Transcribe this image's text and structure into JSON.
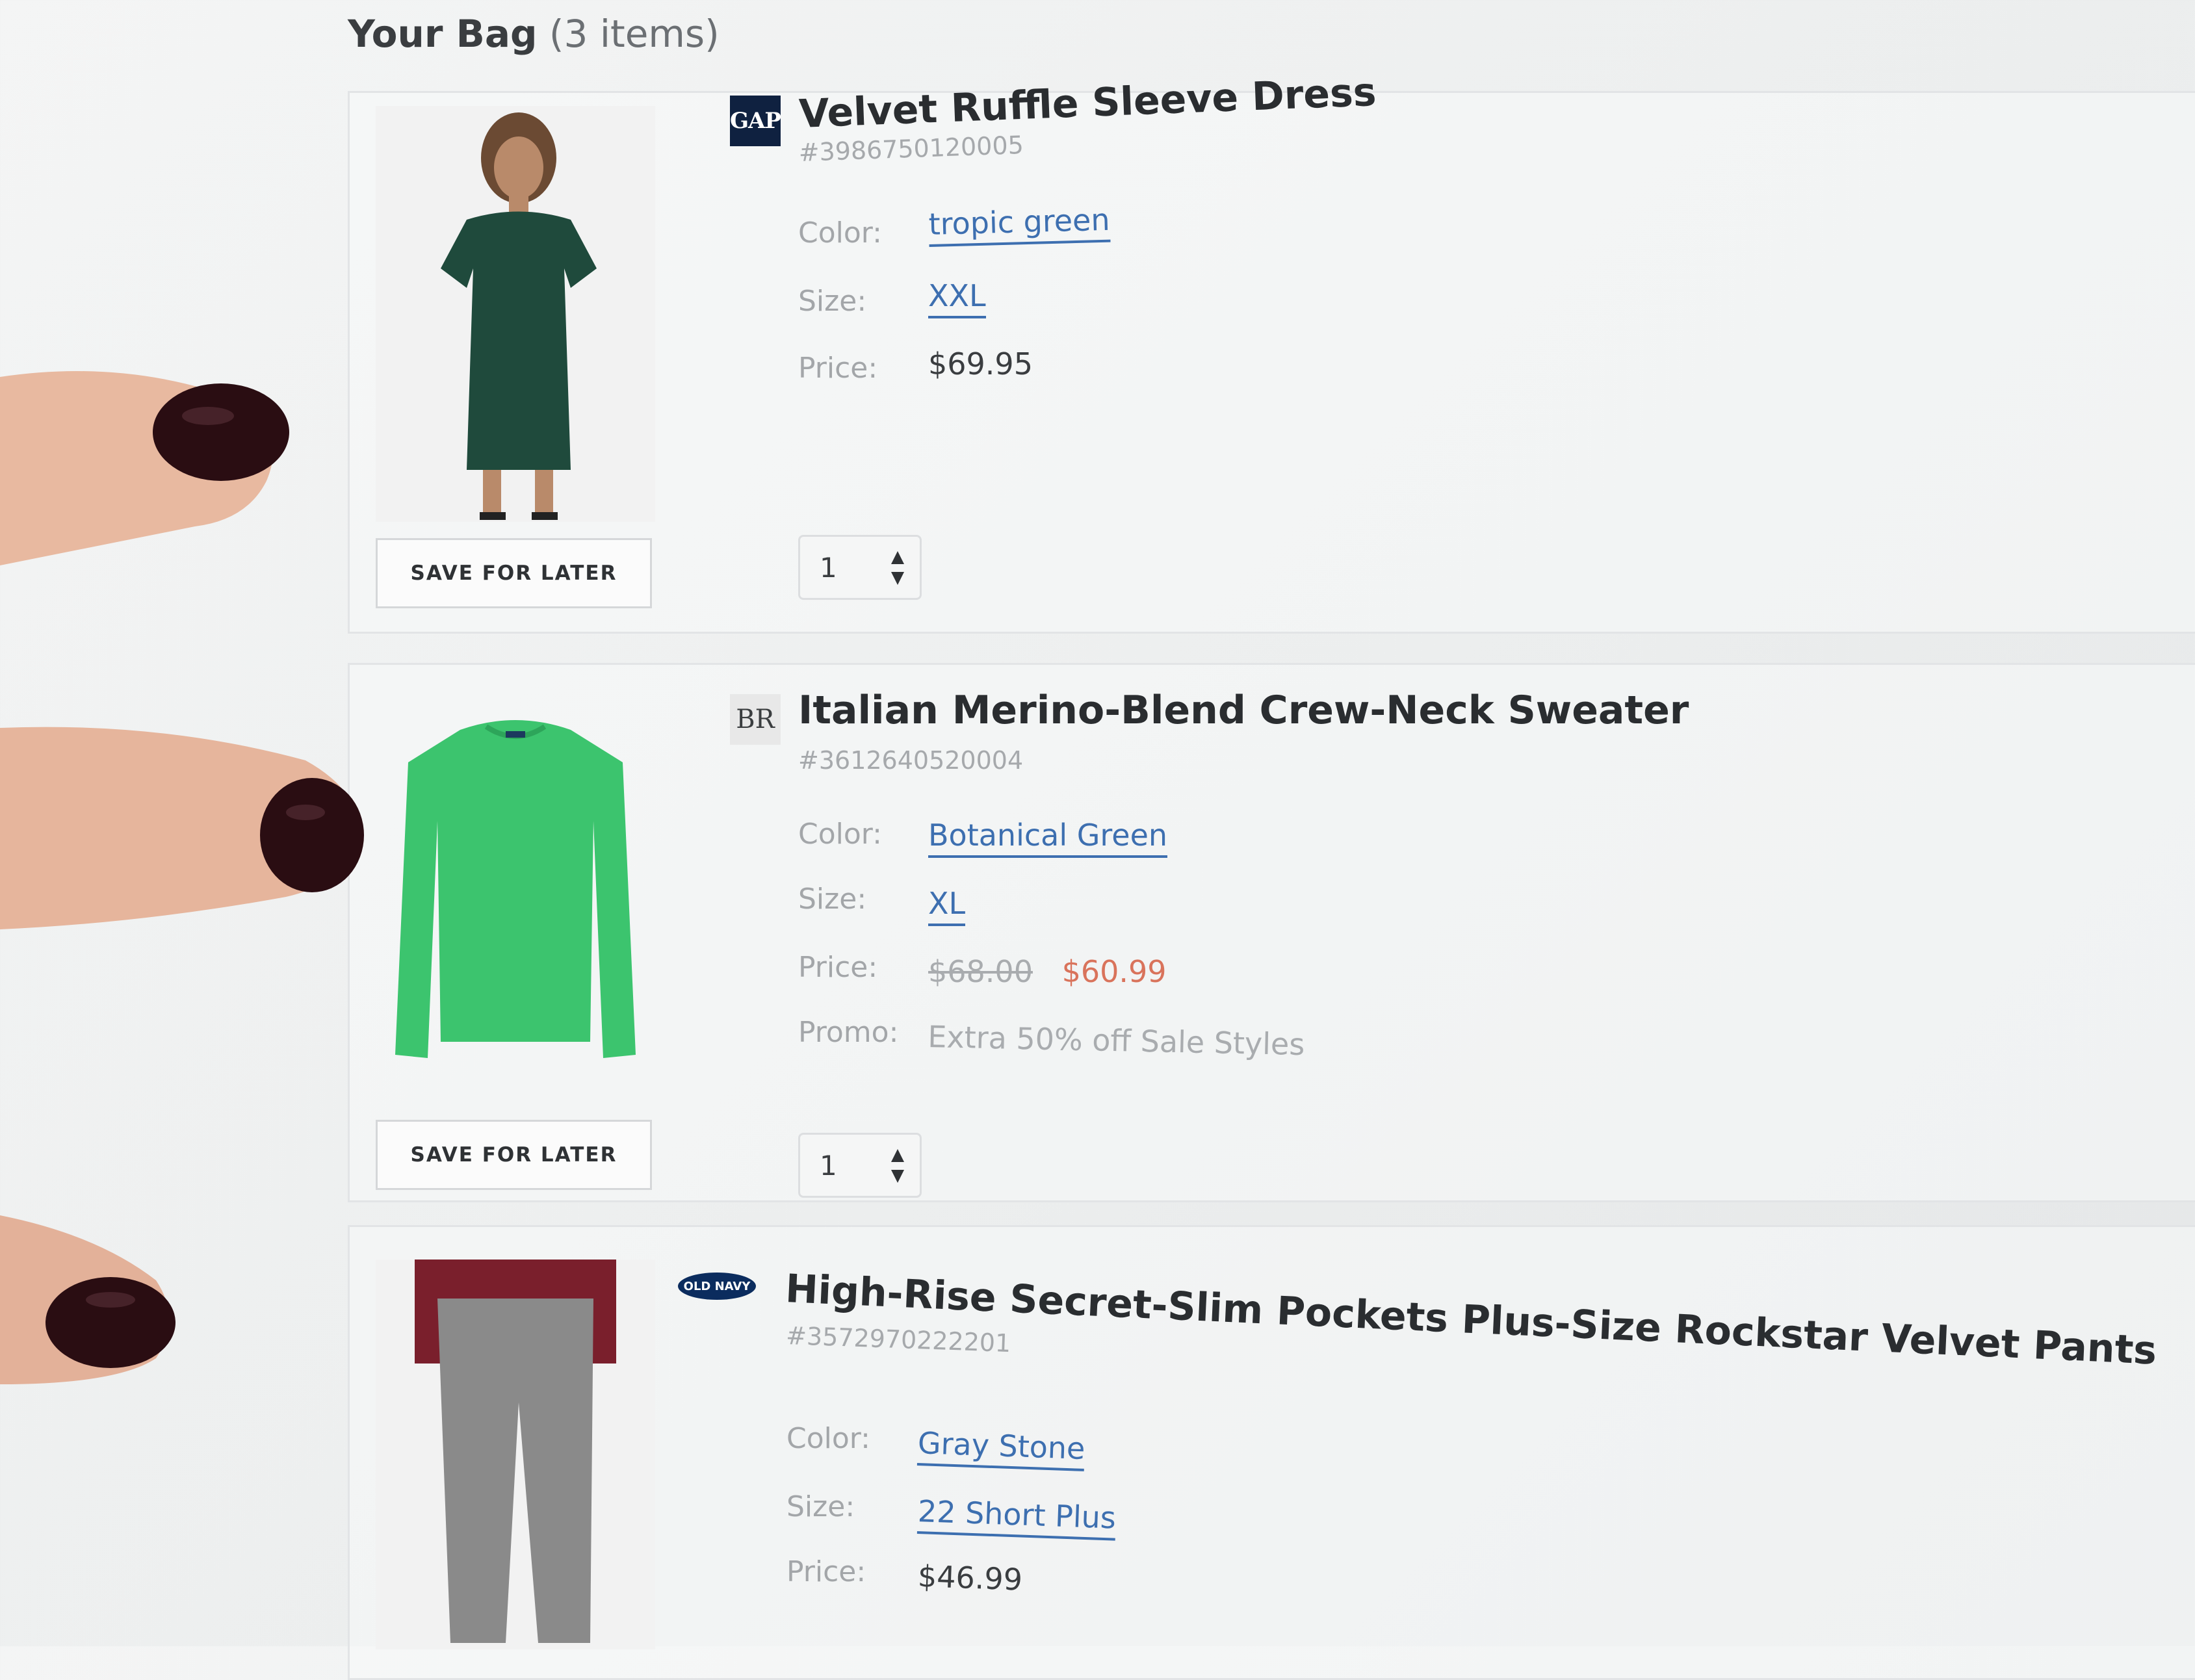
{
  "bag": {
    "title": "Your Bag",
    "count": "(3 items)"
  },
  "labels": {
    "color": "Color:",
    "size": "Size:",
    "price": "Price:",
    "promo": "Promo:",
    "save_for_later": "SAVE FOR LATER"
  },
  "items": [
    {
      "brand": "GAP",
      "name": "Velvet Ruffle Sleeve Dress",
      "sku": "#3986750120005",
      "color": "tropic green",
      "size": "XXL",
      "price": "$69.95",
      "qty": "1",
      "swatch": "#1f4a3c"
    },
    {
      "brand": "BR",
      "name": "Italian Merino-Blend Crew-Neck Sweater",
      "sku": "#3612640520004",
      "color": "Botanical Green",
      "size": "XL",
      "price_original": "$68.00",
      "price_sale": "$60.99",
      "promo": "Extra 50% off Sale Styles",
      "qty": "1",
      "swatch": "#3cc46e"
    },
    {
      "brand": "OLD NAVY",
      "name": "High-Rise Secret-Slim Pockets Plus-Size Rockstar Velvet Pants",
      "sku": "#3572970222201",
      "color": "Gray Stone",
      "size": "22 Short Plus",
      "price": "$46.99",
      "swatch": "#8a8a8a"
    }
  ],
  "colors": {
    "link": "#3d6fb0",
    "sale": "#d9735b",
    "nail_polish": "#2a0d12"
  }
}
